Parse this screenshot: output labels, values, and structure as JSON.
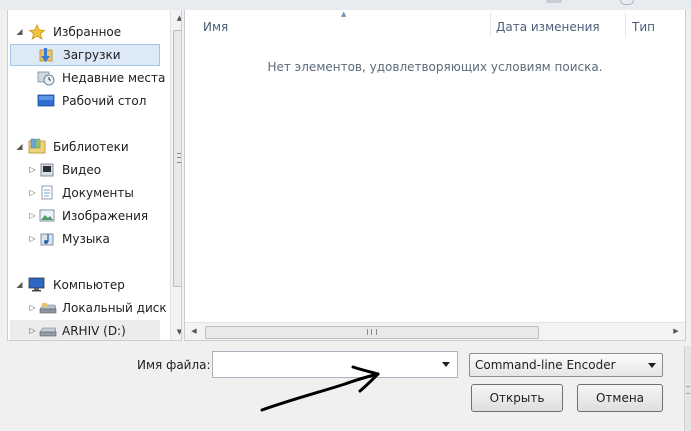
{
  "nav": {
    "favorites": {
      "label": "Избранное",
      "items": [
        {
          "label": "Загрузки",
          "icon": "downloads-folder-icon",
          "selected": true
        },
        {
          "label": "Недавние места",
          "icon": "recent-places-icon"
        },
        {
          "label": "Рабочий стол",
          "icon": "desktop-icon"
        }
      ]
    },
    "libraries": {
      "label": "Библиотеки",
      "items": [
        {
          "label": "Видео",
          "icon": "video-library-icon"
        },
        {
          "label": "Документы",
          "icon": "documents-library-icon"
        },
        {
          "label": "Изображения",
          "icon": "pictures-library-icon"
        },
        {
          "label": "Музыка",
          "icon": "music-library-icon"
        }
      ]
    },
    "computer": {
      "label": "Компьютер",
      "items": [
        {
          "label": "Локальный диск",
          "icon": "local-disk-icon"
        },
        {
          "label": "ARHIV (D:)",
          "icon": "drive-icon"
        }
      ]
    }
  },
  "filelist": {
    "columns": [
      "Имя",
      "Дата изменения",
      "Тип"
    ],
    "empty_message": "Нет элементов, удовлетворяющих условиям поиска."
  },
  "bottom": {
    "filename_label": "Имя файла:",
    "filename_value": "",
    "filetype_value": "Command-line Encoder",
    "open_label": "Открыть",
    "cancel_label": "Отмена"
  },
  "colors": {
    "selection": "#dce9f7",
    "selection_border": "#a7c5e8",
    "header_text": "#4c607a",
    "annotation": "#000000"
  }
}
